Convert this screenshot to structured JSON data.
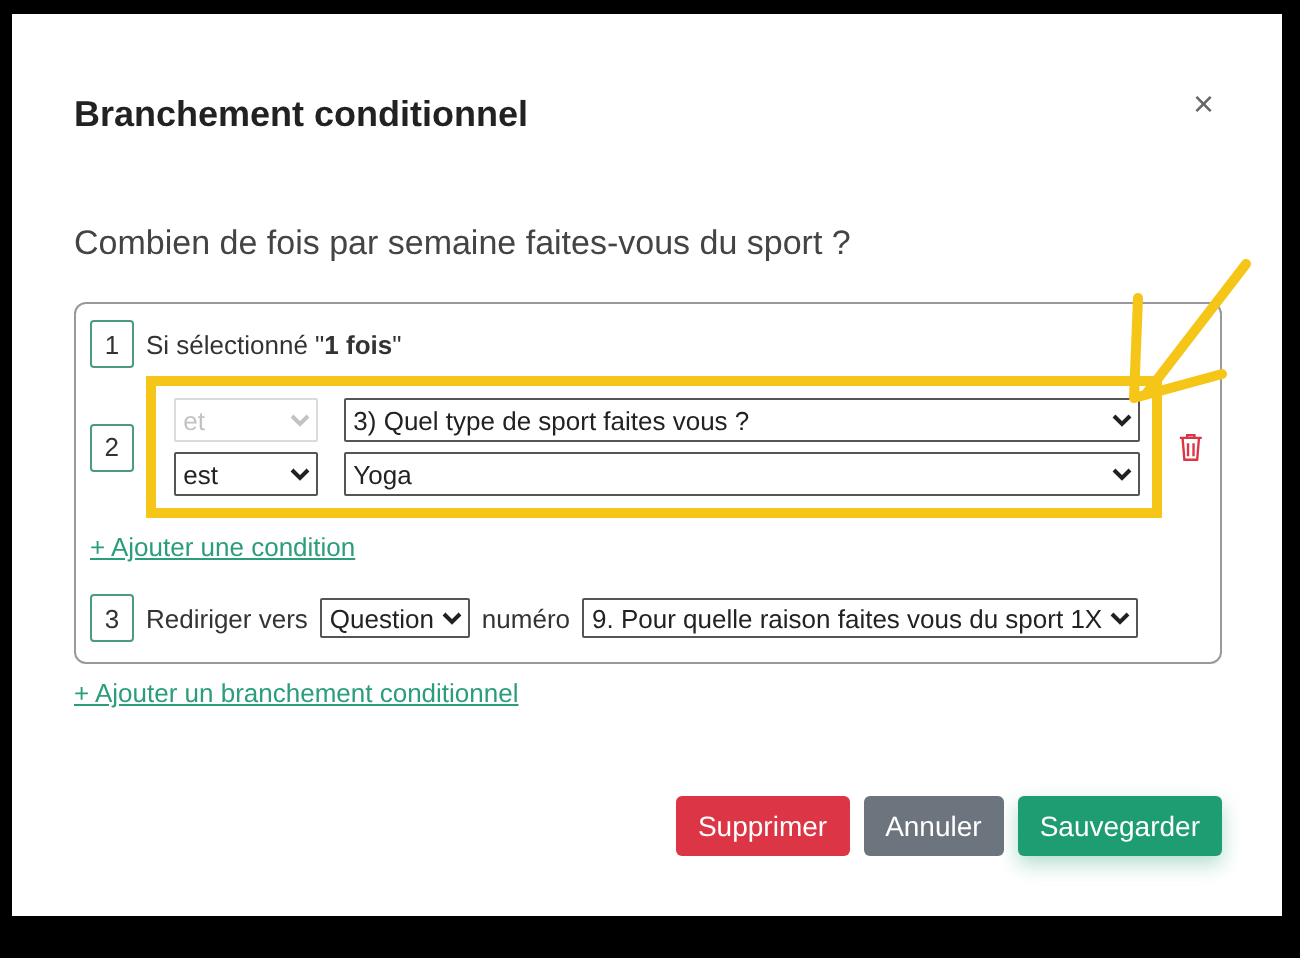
{
  "dialog": {
    "title": "Branchement conditionnel",
    "close": "×"
  },
  "question": "Combien de fois par semaine faites-vous du sport ?",
  "steps": [
    {
      "kind": "trigger",
      "number": "1",
      "text": "Si sélectionné \"**1 fois**\""
    },
    {
      "kind": "conditions",
      "number": "2",
      "rows": [
        {
          "left": {
            "value": "et",
            "disabled": true
          },
          "right": {
            "value": "3) Quel type de sport faites vous ?"
          }
        },
        {
          "left": {
            "value": "est",
            "disabled": false
          },
          "right": {
            "value": "Yoga"
          }
        }
      ],
      "add_link": "+ Ajouter une condition"
    },
    {
      "kind": "redirect",
      "number": "3",
      "label": "Rediriger vers",
      "target": "Question",
      "connector": "numéro",
      "question": "9. Pour quelle raison faites vous du sport 1X"
    }
  ],
  "add_branch_link": "+ Ajouter un branchement conditionnel",
  "buttons": [
    {
      "label": "Supprimer",
      "kind": "danger"
    },
    {
      "label": "Annuler",
      "kind": "secondary"
    },
    {
      "label": "Sauvegarder",
      "kind": "success"
    }
  ]
}
